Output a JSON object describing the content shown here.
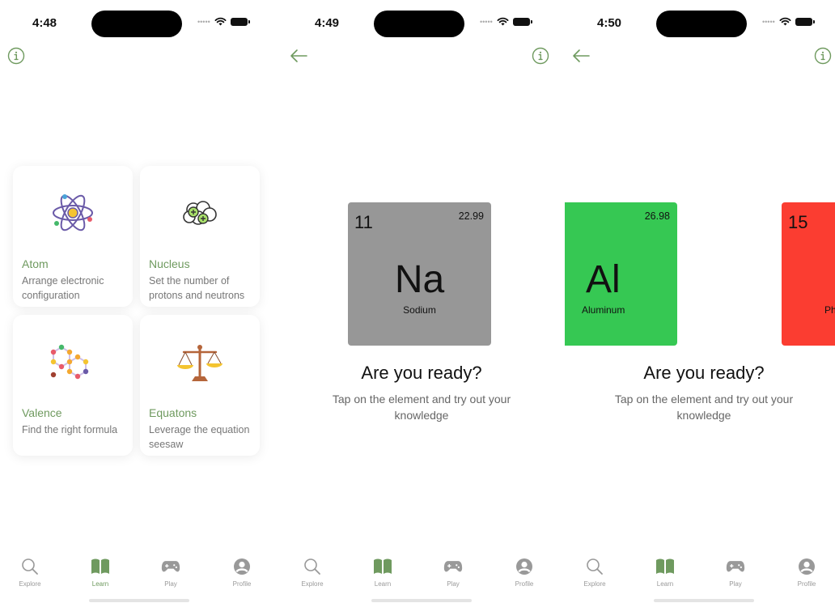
{
  "colors": {
    "accent": "#6f9a5f",
    "sodium": "#979797",
    "aluminum": "#36c853",
    "phosphorus": "#fb3d31"
  },
  "screens": [
    {
      "time": "4:48",
      "cards": [
        {
          "title": "Atom",
          "desc": "Arrange electronic configuration",
          "icon": "atom-icon"
        },
        {
          "title": "Nucleus",
          "desc": "Set the number of protons and neutrons",
          "icon": "nucleus-icon"
        },
        {
          "title": "Valence",
          "desc": "Find the right formula",
          "icon": "molecule-icon"
        },
        {
          "title": "Equatons",
          "desc": "Leverage the equation seesaw",
          "icon": "balance-scale-icon"
        }
      ]
    },
    {
      "time": "4:49",
      "element": {
        "number": "11",
        "mass": "22.99",
        "symbol": "Na",
        "name": "Sodium"
      },
      "heading": "Are you ready?",
      "subtitle": "Tap on the element and try out your knowledge"
    },
    {
      "time": "4:50",
      "elements": [
        {
          "mass": "26.98",
          "symbol": "Al",
          "name": "Aluminum"
        },
        {
          "number": "15",
          "name_partial": "Ph"
        }
      ],
      "heading": "Are you ready?",
      "subtitle": "Tap on the element and try out your knowledge"
    }
  ],
  "tabs": [
    {
      "label": "Explore",
      "icon": "search-icon"
    },
    {
      "label": "Learn",
      "icon": "book-icon",
      "active": true
    },
    {
      "label": "Play",
      "icon": "gamepad-icon"
    },
    {
      "label": "Profile",
      "icon": "profile-icon"
    }
  ]
}
